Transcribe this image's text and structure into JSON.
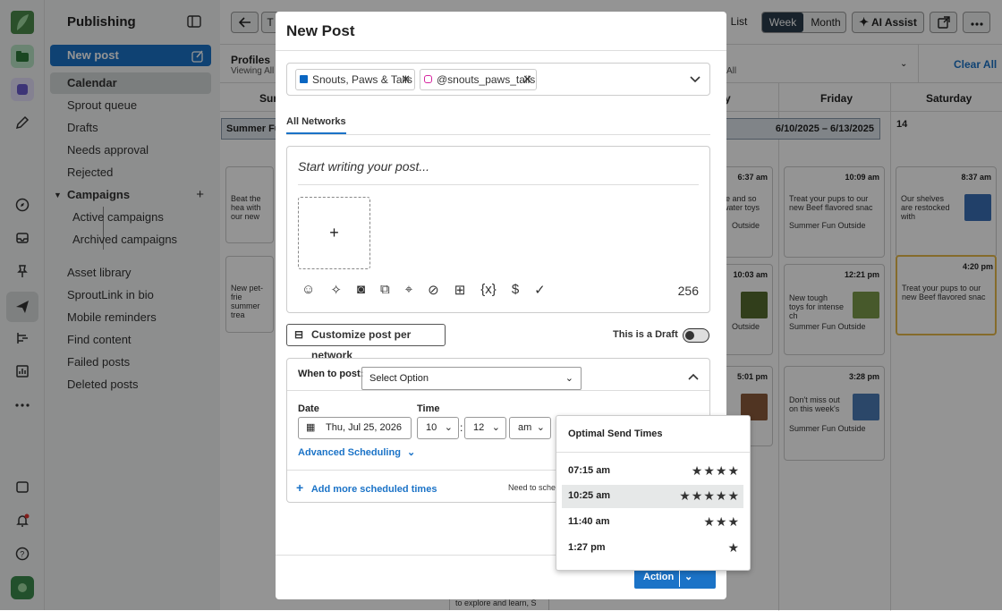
{
  "nav": {
    "title": "Publishing",
    "items": [
      {
        "label": "New post"
      },
      {
        "label": "Calendar"
      },
      {
        "label": "Sprout queue"
      },
      {
        "label": "Drafts"
      },
      {
        "label": "Needs approval"
      },
      {
        "label": "Rejected"
      },
      {
        "label": "Campaigns"
      },
      {
        "label": "Active campaigns"
      },
      {
        "label": "Archived campaigns"
      },
      {
        "label": "Asset library"
      },
      {
        "label": "SproutLink in bio"
      },
      {
        "label": "Mobile reminders"
      },
      {
        "label": "Find content"
      },
      {
        "label": "Failed posts"
      },
      {
        "label": "Deleted posts"
      }
    ]
  },
  "topbar": {
    "list": "List",
    "week": "Week",
    "month": "Month",
    "ai_assist": "AI Assist",
    "clear_all": "Clear All",
    "profiles": "Profiles",
    "viewing": "Viewing All",
    "all": "All",
    "sun_partial": "Sun",
    "campaign_partial": "Summer Fu",
    "date_range": "6/10/2025 – 6/13/2025",
    "day14": "14",
    "days": [
      "day",
      "Friday",
      "Saturday"
    ],
    "t": "T"
  },
  "calendar": {
    "posts": [
      {
        "time": "6:37 am",
        "text": "re and so water toys",
        "tag": "Outside"
      },
      {
        "time": "10:09 am",
        "text": "Treat your pups to our new Beef flavored snac",
        "tag": "Summer Fun Outside"
      },
      {
        "time": "8:37 am",
        "text": "Our shelves are restocked with",
        "tag": ""
      },
      {
        "time": "10:03 am",
        "text": "",
        "tag": "Outside"
      },
      {
        "time": "12:21 pm",
        "text": "New tough toys for intense ch",
        "tag": "Summer Fun Outside"
      },
      {
        "time": "4:20 pm",
        "text": "Treat your pups to our new Beef flavored snac",
        "tag": ""
      },
      {
        "time": "5:01 pm",
        "text": "",
        "tag": "Outside"
      },
      {
        "time": "3:28 pm",
        "text": "Don't miss out on this week's",
        "tag": "Summer Fun Outside"
      },
      {
        "time": "",
        "text": "Beat the hea with our new",
        "tag": ""
      },
      {
        "time": "",
        "text": "New pet-frie summer trea",
        "tag": ""
      },
      {
        "time": "",
        "text": "to explore and learn, S",
        "tag": ""
      }
    ]
  },
  "modal": {
    "title": "New Post",
    "profiles": [
      {
        "name": "Snouts, Paws & Tails",
        "network": "linkedin"
      },
      {
        "name": "@snouts_paws_tails",
        "network": "instagram"
      }
    ],
    "tab": "All Networks",
    "placeholder": "Start writing your post...",
    "char_count": "256",
    "customize": "Customize post per network",
    "draft_label": "This is a Draft",
    "when_label": "When to post:",
    "select_option": "Select Option",
    "date_label": "Date",
    "date_value": "Thu, Jul 25, 2026",
    "time_label": "Time",
    "hour": "10",
    "minute": "12",
    "ampm": "am",
    "advanced": "Advanced Scheduling",
    "add_more": "Add more scheduled times",
    "need_to": "Need to sche",
    "action": "Action"
  },
  "optimal": {
    "title": "Optimal Send Times",
    "times": [
      {
        "time": "07:15 am",
        "stars": 4
      },
      {
        "time": "10:25 am",
        "stars": 5
      },
      {
        "time": "11:40 am",
        "stars": 3
      },
      {
        "time": "1:27 pm",
        "stars": 1
      }
    ]
  },
  "colors": {
    "accent": "#1b73c7",
    "brand_green": "#3b8b4d",
    "dim": "#6b6b6b"
  }
}
